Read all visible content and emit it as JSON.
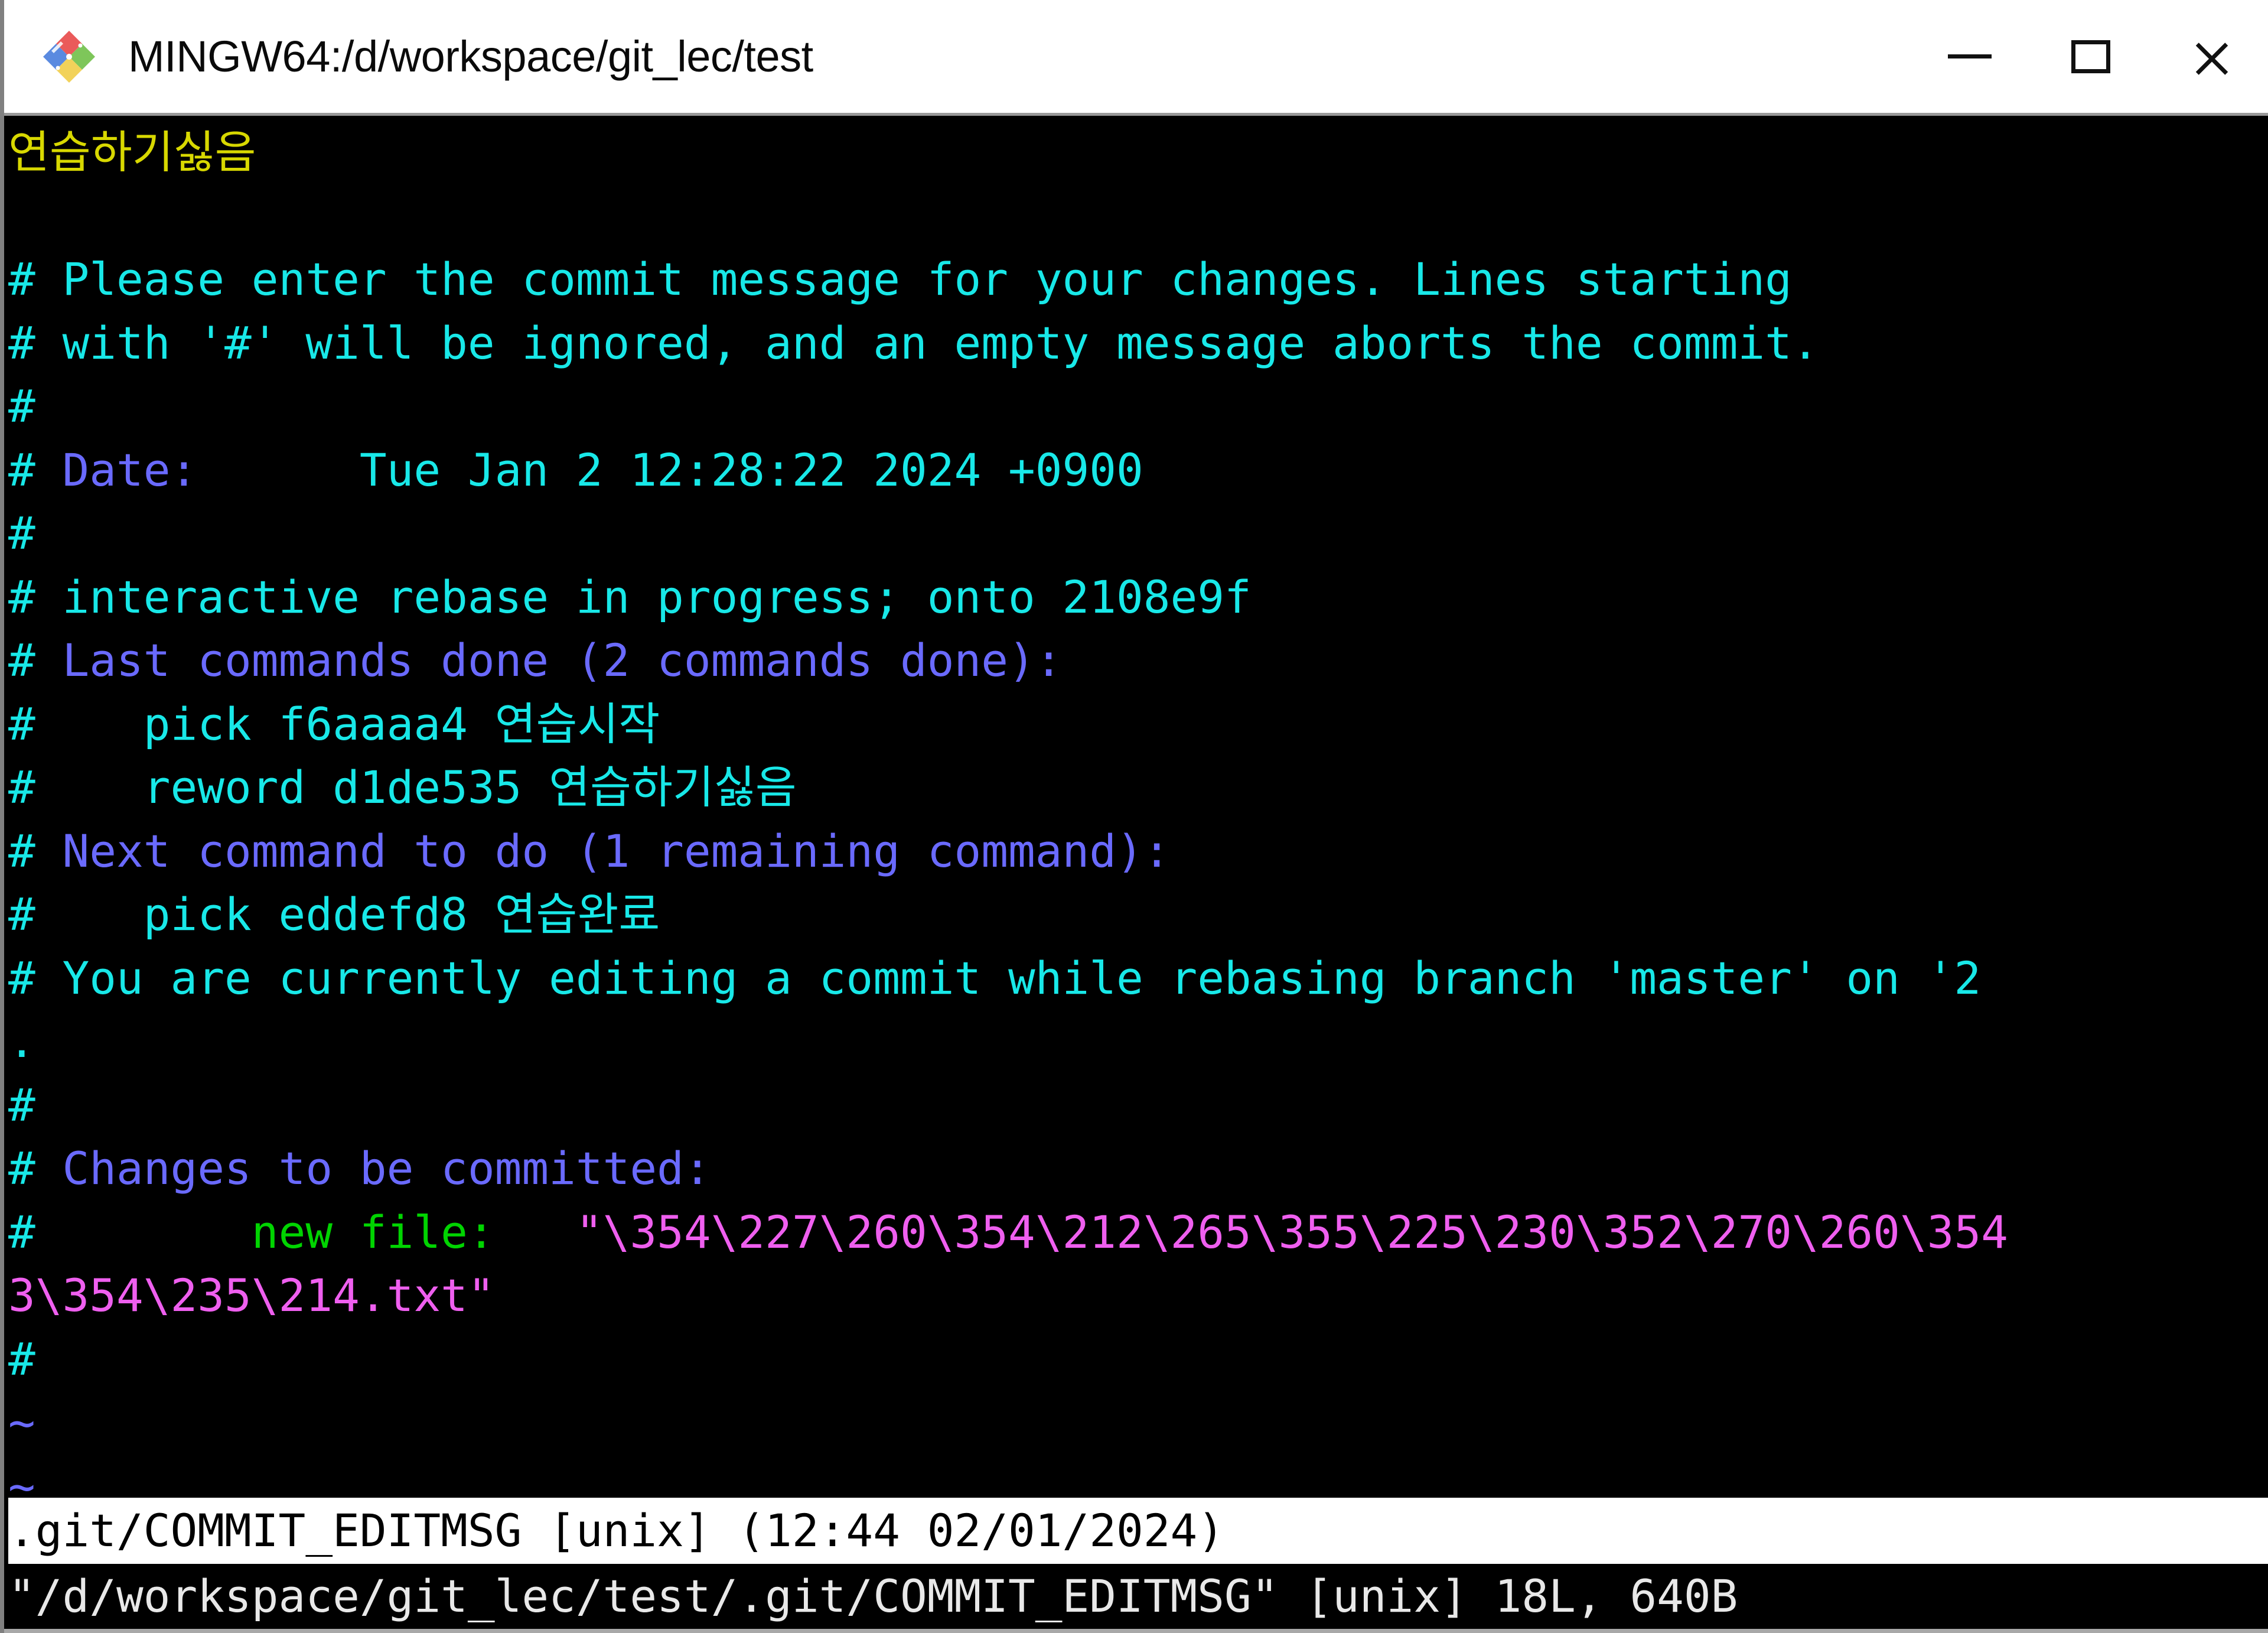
{
  "window": {
    "title": "MINGW64:/d/workspace/git_lec/test",
    "icon": "git-bash-diamond-logo",
    "controls": {
      "minimize": "minimize-icon",
      "maximize": "maximize-icon",
      "close": "close-icon"
    }
  },
  "colors": {
    "background": "#000000",
    "titlebar_bg": "#ffffff",
    "titlebar_text": "#0a0a0a",
    "yellow": "#d8d800",
    "cyan": "#18e8e8",
    "blue": "#6a6aff",
    "green": "#00d400",
    "magenta": "#ef5fef",
    "white": "#e8e8e8",
    "statusline_bg": "#ffffff",
    "statusline_fg": "#000000"
  },
  "editor": {
    "name": "vim",
    "file": ".git/COMMIT_EDITMSG",
    "lines": [
      {
        "id": "commit-message",
        "segments": [
          {
            "text": "연습하기싫음",
            "color": "yellow"
          }
        ]
      },
      {
        "id": "blank-1",
        "segments": [
          {
            "text": "",
            "color": "cyan"
          }
        ]
      },
      {
        "id": "comment-please-enter",
        "segments": [
          {
            "text": "# Please enter the commit message for your changes. Lines starting",
            "color": "cyan"
          }
        ]
      },
      {
        "id": "comment-with-hash",
        "segments": [
          {
            "text": "# with '#' will be ignored, and an empty message aborts the commit.",
            "color": "cyan"
          }
        ]
      },
      {
        "id": "comment-hash-1",
        "segments": [
          {
            "text": "#",
            "color": "cyan"
          }
        ]
      },
      {
        "id": "comment-date",
        "segments": [
          {
            "text": "# ",
            "color": "cyan"
          },
          {
            "text": "Date:",
            "color": "blue"
          },
          {
            "text": "      Tue Jan 2 12:28:22 2024 +0900",
            "color": "cyan"
          }
        ]
      },
      {
        "id": "comment-hash-2",
        "segments": [
          {
            "text": "#",
            "color": "cyan"
          }
        ]
      },
      {
        "id": "comment-rebase",
        "segments": [
          {
            "text": "# interactive rebase in progress; onto 2108e9f",
            "color": "cyan"
          }
        ]
      },
      {
        "id": "comment-last-commands",
        "segments": [
          {
            "text": "# ",
            "color": "cyan"
          },
          {
            "text": "Last commands done (2 commands done):",
            "color": "blue"
          }
        ]
      },
      {
        "id": "comment-pick-f6aaaa4",
        "segments": [
          {
            "text": "#    pick f6aaaa4 연습시작",
            "color": "cyan"
          }
        ]
      },
      {
        "id": "comment-reword-d1de535",
        "segments": [
          {
            "text": "#    reword d1de535 연습하기싫음",
            "color": "cyan"
          }
        ]
      },
      {
        "id": "comment-next-command",
        "segments": [
          {
            "text": "# ",
            "color": "cyan"
          },
          {
            "text": "Next command to do (1 remaining command):",
            "color": "blue"
          }
        ]
      },
      {
        "id": "comment-pick-eddefd8",
        "segments": [
          {
            "text": "#    pick eddefd8 연습완료",
            "color": "cyan"
          }
        ]
      },
      {
        "id": "comment-editing-commit",
        "segments": [
          {
            "text": "# You are currently editing a commit while rebasing branch 'master' on '2",
            "color": "cyan"
          }
        ]
      },
      {
        "id": "comment-editing-wrap",
        "segments": [
          {
            "text": ".",
            "color": "cyan"
          }
        ]
      },
      {
        "id": "comment-hash-3",
        "segments": [
          {
            "text": "#",
            "color": "cyan"
          }
        ]
      },
      {
        "id": "comment-changes",
        "segments": [
          {
            "text": "# ",
            "color": "cyan"
          },
          {
            "text": "Changes to be committed:",
            "color": "blue"
          }
        ]
      },
      {
        "id": "comment-new-file",
        "segments": [
          {
            "text": "# ",
            "color": "cyan"
          },
          {
            "text": "       new file:   ",
            "color": "green"
          },
          {
            "text": "\"\\354\\227\\260\\354\\212\\265\\355\\225\\230\\352\\270\\260\\354",
            "color": "magenta"
          }
        ]
      },
      {
        "id": "comment-new-file-wrap",
        "segments": [
          {
            "text": "3\\354\\235\\214.txt\"",
            "color": "magenta"
          }
        ]
      },
      {
        "id": "comment-hash-4",
        "segments": [
          {
            "text": "#",
            "color": "cyan"
          }
        ]
      },
      {
        "id": "tilde-1",
        "segments": [
          {
            "text": "~",
            "color": "blue"
          }
        ]
      },
      {
        "id": "tilde-2",
        "segments": [
          {
            "text": "~",
            "color": "blue"
          }
        ]
      }
    ],
    "statusline": ".git/COMMIT_EDITMSG [unix] (12:44 02/01/2024)",
    "messageline": "\"/d/workspace/git_lec/test/.git/COMMIT_EDITMSG\" [unix] 18L, 640B"
  }
}
